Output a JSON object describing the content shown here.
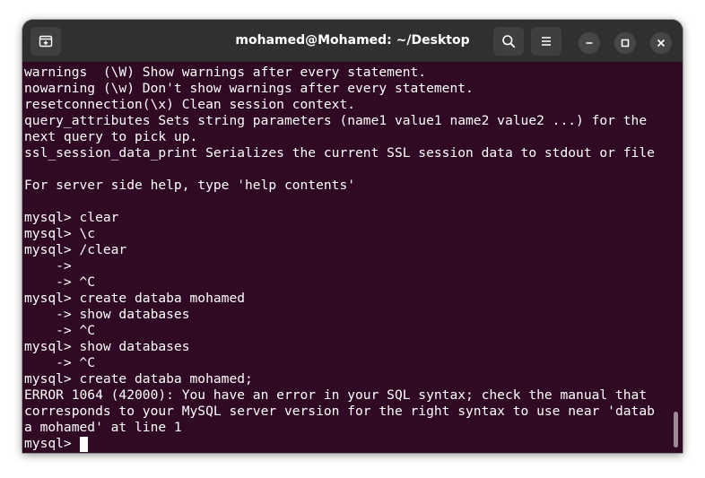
{
  "window": {
    "title": "mohamed@Mohamed: ~/Desktop"
  },
  "titlebar": {
    "new_tab_icon": "new-tab-icon",
    "search_icon": "search-icon",
    "menu_icon": "hamburger-menu-icon",
    "minimize_icon": "minimize-icon",
    "maximize_icon": "maximize-icon",
    "close_icon": "close-icon"
  },
  "colors": {
    "terminal_bg": "#300a24",
    "titlebar_bg": "#303030",
    "text": "#ffffff"
  },
  "terminal": {
    "lines": [
      "warnings  (\\W) Show warnings after every statement.",
      "nowarning (\\w) Don't show warnings after every statement.",
      "resetconnection(\\x) Clean session context.",
      "query_attributes Sets string parameters (name1 value1 name2 value2 ...) for the",
      "next query to pick up.",
      "ssl_session_data_print Serializes the current SSL session data to stdout or file",
      "",
      "For server side help, type 'help contents'",
      "",
      "mysql> clear",
      "mysql> \\c",
      "mysql> /clear",
      "    ->",
      "    -> ^C",
      "mysql> create databa mohamed",
      "    -> show databases",
      "    -> ^C",
      "mysql> show databases",
      "    -> ^C",
      "mysql> create databa mohamed;",
      "ERROR 1064 (42000): You have an error in your SQL syntax; check the manual that",
      "corresponds to your MySQL server version for the right syntax to use near 'datab",
      "a mohamed' at line 1"
    ],
    "prompt": "mysql> "
  }
}
